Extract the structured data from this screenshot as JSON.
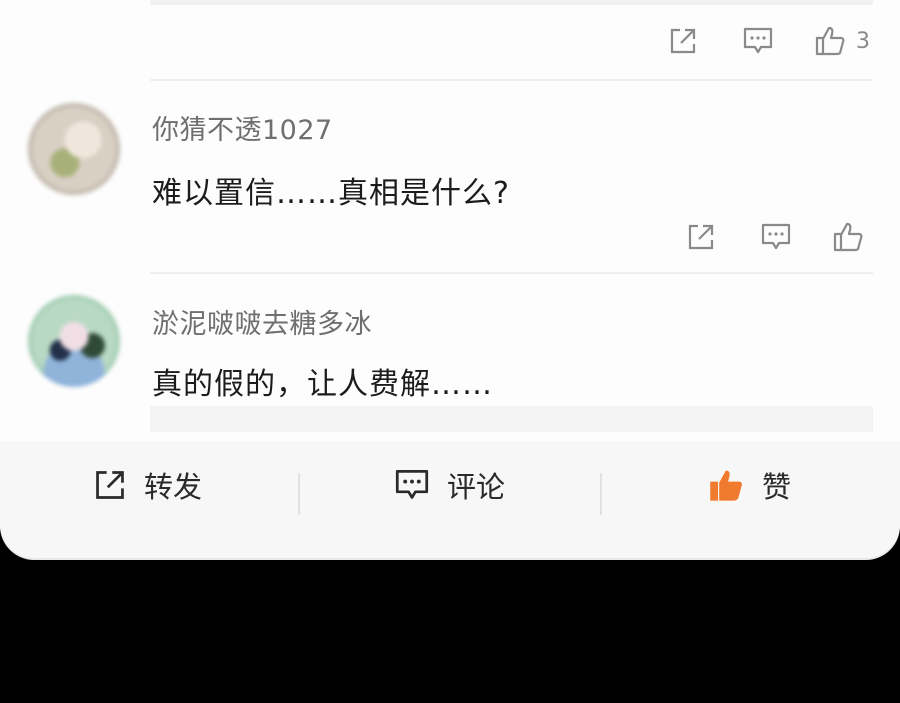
{
  "comments": [
    {
      "username": "",
      "content": "",
      "actions": {
        "like_count": "3"
      }
    },
    {
      "username": "你猜不透1027",
      "content": "难以置信……真相是什么?"
    },
    {
      "username": "淤泥啵啵去糖多冰",
      "content": "真的假的，让人费解……"
    }
  ],
  "bottom_bar": {
    "repost_label": "转发",
    "comment_label": "评论",
    "like_label": "赞"
  },
  "colors": {
    "accent_like": "#f07a2e",
    "icon_gray": "#8a8a8a",
    "background_gradient_top": "#6a1fe0"
  }
}
